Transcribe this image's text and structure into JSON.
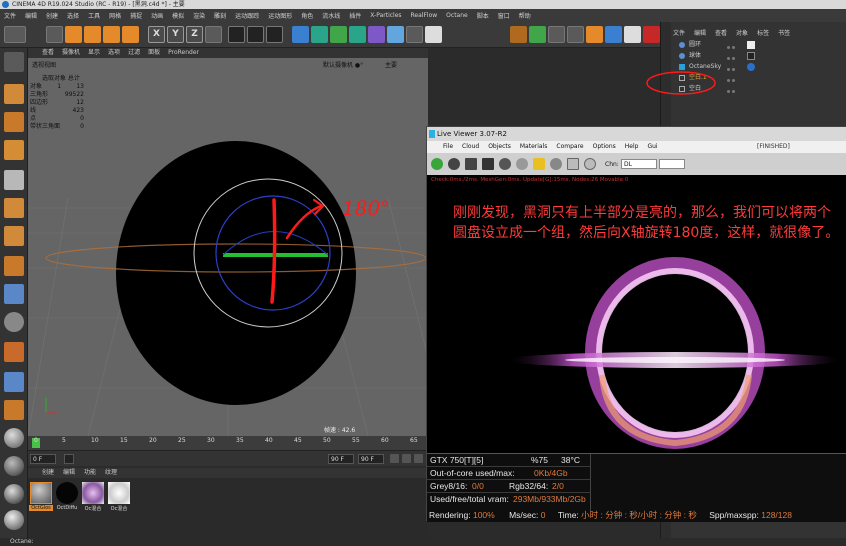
{
  "window": {
    "title": "CINEMA 4D R19.024 Studio (RC - R19) - [黑洞.c4d *] - 主要"
  },
  "menubar": [
    "文件",
    "编辑",
    "创建",
    "选择",
    "工具",
    "网格",
    "捕捉",
    "动画",
    "模拟",
    "渲染",
    "雕刻",
    "运动跟踪",
    "运动图形",
    "角色",
    "流水线",
    "插件",
    "X-Particles",
    "RealFlow",
    "Octane",
    "脚本",
    "窗口",
    "帮助"
  ],
  "viewport": {
    "menu": [
      "查看",
      "摄像机",
      "显示",
      "选项",
      "过滤",
      "面板",
      "ProRender"
    ],
    "label": "透视视图",
    "camera": "默认摄像机 ●°",
    "main_tab": "主要",
    "stats_title": "选取对象 总计",
    "stats": [
      {
        "k": "对象",
        "a": "1",
        "b": "13"
      },
      {
        "k": "三角形",
        "a": "",
        "b": "99522"
      },
      {
        "k": "四边形",
        "a": "",
        "b": "12"
      },
      {
        "k": "线",
        "a": "",
        "b": "423"
      },
      {
        "k": "点",
        "a": "",
        "b": "0"
      },
      {
        "k": "带状三角面",
        "a": "",
        "b": "0"
      }
    ],
    "fps": "帧速 : 42.6",
    "annotation": "180°"
  },
  "timeline": {
    "ticks": [
      "0",
      "5",
      "10",
      "15",
      "20",
      "25",
      "30",
      "35",
      "40",
      "45",
      "50",
      "55",
      "60",
      "65"
    ],
    "start_field": "0 F",
    "end_field": "90 F",
    "current_field": "90 F",
    "max_field": "0 F"
  },
  "materials": {
    "menu": [
      "创建",
      "编辑",
      "功能",
      "纹理"
    ],
    "items": [
      {
        "name": "OctGlos",
        "color": "#8a8a8a"
      },
      {
        "name": "OctDiffu",
        "color": "#050505"
      },
      {
        "name": "Oc混合",
        "color": "#c7a0d8"
      },
      {
        "name": "Oc混合",
        "color": "#e8e8e8"
      }
    ]
  },
  "objects": {
    "menu": [
      "文件",
      "编辑",
      "查看",
      "对象",
      "标签",
      "书签"
    ],
    "rows": [
      {
        "name": "圆环",
        "color": "#5b8fd6"
      },
      {
        "name": "球体",
        "color": "#5b8fd6"
      },
      {
        "name": "OctaneSky",
        "color": "#2ba0d8"
      },
      {
        "name": "空白.1",
        "color": "#aaaaaa"
      },
      {
        "name": "空白",
        "color": "#aaaaaa"
      }
    ]
  },
  "liveviewer": {
    "title": "Live Viewer 3.07-R2",
    "menu": [
      "File",
      "Cloud",
      "Objects",
      "Materials",
      "Compare",
      "Options",
      "Help",
      "Gui"
    ],
    "status": "[FINISHED]",
    "chn_label": "Chn:",
    "chn_value": "DL",
    "info": "Check:0ms./2ms. MeshGen:0ms. Update[G]:15ms. Nodes:26 Movable:0",
    "annotation": "刚刚发现，黑洞只有上半部分是亮的，那么，我们可以将两个圆盘设立成一个组，然后向X轴旋转180度，这样，就很像了。",
    "gpu": "GTX 750[T][5]",
    "gpu_pct": "%75",
    "gpu_temp": "38°C",
    "out_of_core_label": "Out-of-core used/max:",
    "out_of_core_val": "0Kb/4Gb",
    "grey_label": "Grey8/16:",
    "grey_val": "0/0",
    "rgb_label": "Rgb32/64:",
    "rgb_val": "2/0",
    "vram_label": "Used/free/total vram:",
    "vram_val": "293Mb/933Mb/2Gb",
    "rendering_label": "Rendering:",
    "rendering_val": "100%",
    "ms_label": "Ms/sec:",
    "ms_val": "0",
    "time_label": "Time:",
    "time_val": "小时 : 分钟 : 秒/小时 : 分钟 : 秒",
    "spp_label": "Spp/maxspp:",
    "spp_val": "128/128"
  },
  "statusbar": "Octane:"
}
